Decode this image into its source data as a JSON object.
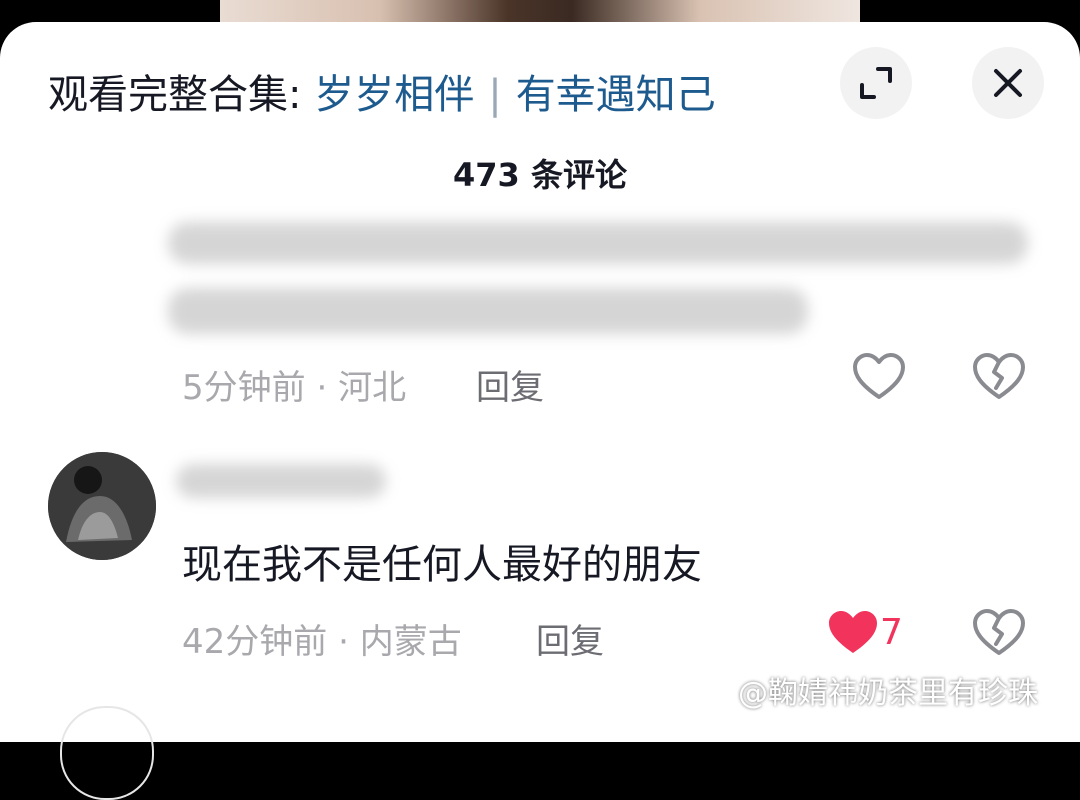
{
  "header": {
    "prefix": "观看完整合集: ",
    "collection_1": "岁岁相伴",
    "separator": "|",
    "collection_2": "有幸遇知己"
  },
  "comments_panel": {
    "count_label": "473 条评论"
  },
  "comment_1": {
    "time": "5分钟前",
    "dot": "·",
    "location": "河北",
    "reply_label": "回复"
  },
  "comment_2": {
    "text": "现在我不是任何人最好的朋友",
    "time": "42分钟前",
    "dot": "·",
    "location": "内蒙古",
    "reply_label": "回复",
    "like_count": "7"
  },
  "watermark": {
    "text": "@鞠婧祎奶茶里有珍珠"
  },
  "colors": {
    "accent_link": "#1d5a8e",
    "like_red": "#f2335c",
    "meta_gray": "#a8a8ad"
  }
}
